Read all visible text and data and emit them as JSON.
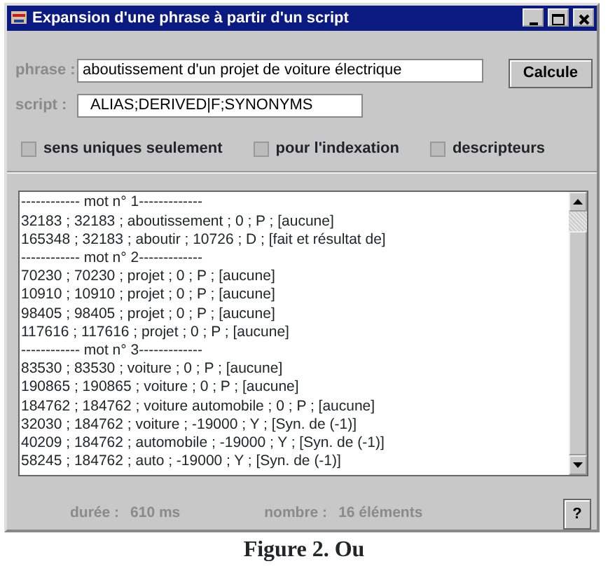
{
  "window": {
    "title": "Expansion d'une phrase à partir d'un script"
  },
  "fields": [
    {
      "label": "phrase :",
      "value": "aboutissement d'un projet de voiture électrique"
    },
    {
      "label": "script :",
      "value": "  ALIAS;DERIVED|F;SYNONYMS"
    }
  ],
  "calc_button": "Calcule",
  "options": [
    {
      "label": "sens uniques seulement",
      "checked": false
    },
    {
      "label": "pour l'indexation",
      "checked": false
    },
    {
      "label": "descripteurs",
      "checked": false
    }
  ],
  "results": [
    "------------ mot n° 1-------------",
    "32183 ; 32183 ; aboutissement ; 0 ; P ; [aucune]",
    "165348 ; 32183 ; aboutir ; 10726 ; D ; [fait et résultat de]",
    "------------ mot n° 2-------------",
    "70230 ; 70230 ; projet ; 0 ; P ; [aucune]",
    "10910 ; 10910 ; projet ; 0 ; P ; [aucune]",
    "98405 ; 98405 ; projet ; 0 ; P ; [aucune]",
    "117616 ; 117616 ; projet ; 0 ; P ; [aucune]",
    "------------ mot n° 3-------------",
    "83530 ; 83530 ; voiture ; 0 ; P ; [aucune]",
    "190865 ; 190865 ; voiture ; 0 ; P ; [aucune]",
    "184762 ; 184762 ; voiture automobile ; 0 ; P ; [aucune]",
    "32030 ; 184762 ; voiture ; -19000 ; Y ; [Syn. de (-1)]",
    "40209 ; 184762 ; automobile ; -19000 ; Y ; [Syn. de (-1)]",
    "58245 ; 184762 ; auto ; -19000 ; Y ; [Syn. de (-1)]"
  ],
  "status": [
    {
      "label": "durée :",
      "value": "610 ms"
    },
    {
      "label": "nombre :",
      "value": "16 éléments"
    }
  ],
  "help_button": "?",
  "caption": "Figure 2. Ou"
}
